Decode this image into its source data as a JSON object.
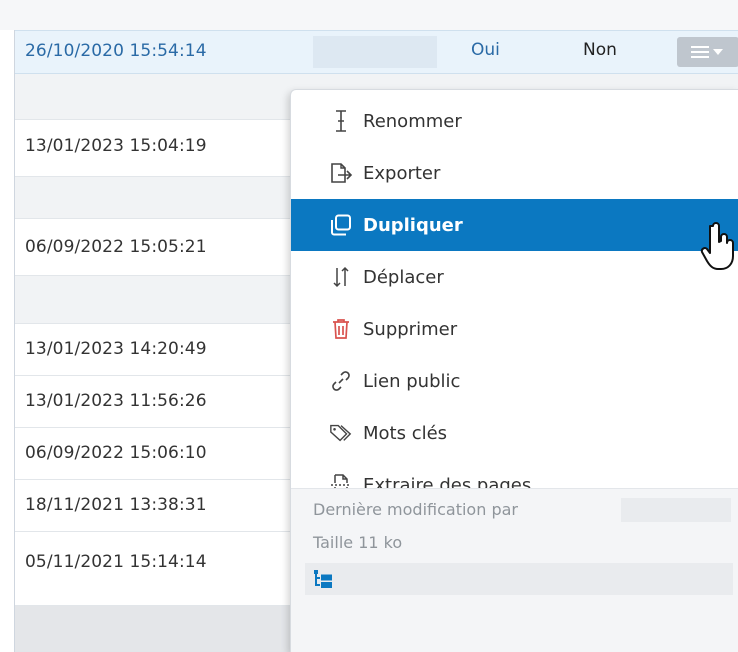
{
  "table": {
    "selected_row": {
      "date": "26/10/2020 15:54:14",
      "col_oui": "Oui",
      "col_non": "Non"
    },
    "rows": [
      {
        "date": "13/01/2023 15:04:19"
      },
      {
        "date": "06/09/2022 15:05:21"
      },
      {
        "date": "13/01/2023 14:20:49"
      },
      {
        "date": "13/01/2023 11:56:26"
      },
      {
        "date": "06/09/2022 15:06:10"
      },
      {
        "date": "18/11/2021 13:38:31"
      },
      {
        "date": "05/11/2021 15:14:14"
      }
    ]
  },
  "row_menu_button": {
    "icon": "hamburger-menu-icon",
    "caret": "caret-down-icon"
  },
  "context_menu": {
    "items": [
      {
        "label": "Renommer",
        "icon": "text-cursor-icon"
      },
      {
        "label": "Exporter",
        "icon": "export-icon"
      },
      {
        "label": "Dupliquer",
        "icon": "duplicate-icon",
        "highlighted": true
      },
      {
        "label": "Déplacer",
        "icon": "move-arrows-icon"
      },
      {
        "label": "Supprimer",
        "icon": "trash-icon",
        "icon_color": "#d9534f"
      },
      {
        "label": "Lien public",
        "icon": "link-icon"
      },
      {
        "label": "Mots clés",
        "icon": "tags-icon"
      },
      {
        "label": "Extraire des pages",
        "icon": "extract-pages-icon"
      }
    ],
    "info": {
      "last_modified_label": "Dernière modification par",
      "size_label": "Taille 11 ko"
    }
  },
  "colors": {
    "accent": "#0b78c1",
    "link_blue": "#2a6aa6",
    "selected_row_bg": "#e9f3fb",
    "menu_button_bg": "#bfc6ce",
    "muted_text": "#8f959b",
    "danger": "#d9534f"
  }
}
